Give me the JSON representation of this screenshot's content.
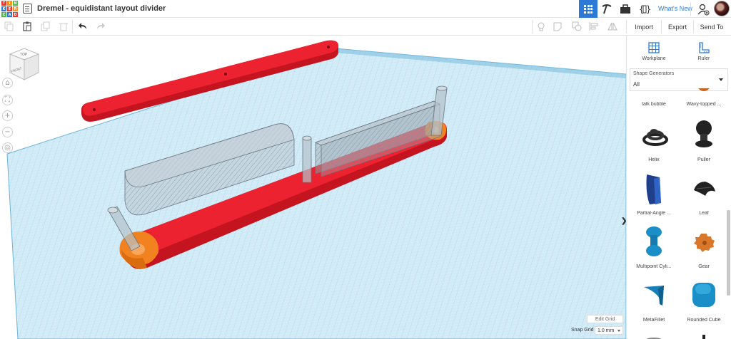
{
  "design_title": "Dremel - equidistant layout divider",
  "logo_letters": [
    "T",
    "I",
    "N",
    "K",
    "E",
    "R",
    "C",
    "A",
    "D"
  ],
  "logo_colors": [
    "#e53b2f",
    "#f7941d",
    "#53b84b",
    "#2d7ad6",
    "#e53b2f",
    "#f7941d",
    "#53b84b",
    "#2d7ad6",
    "#e53b2f"
  ],
  "topbar": {
    "whats_new": "What's New"
  },
  "toolbar": {
    "import_label": "Import",
    "export_label": "Export",
    "send_to_label": "Send To"
  },
  "viewcube": {
    "top": "TOP",
    "front": "FRONT"
  },
  "workplane": {
    "edit_grid": "Edit Grid",
    "snap_grid_label": "Snap Grid",
    "snap_grid_value": "1.0 mm"
  },
  "panel": {
    "workplane_label": "Workplane",
    "ruler_label": "Ruler",
    "shape_generators_label": "Shape Generators",
    "shape_generators_value": "All",
    "shapes": [
      {
        "name": "talk bubble",
        "icon": "talk-bubble-icon"
      },
      {
        "name": "Wavy-topped ...",
        "icon": "wavy-topped-icon"
      },
      {
        "name": "Helix",
        "icon": "helix-icon"
      },
      {
        "name": "Puller",
        "icon": "puller-icon"
      },
      {
        "name": "Partial-Angle ...",
        "icon": "partial-angle-icon"
      },
      {
        "name": "Leaf",
        "icon": "leaf-icon"
      },
      {
        "name": "Multipoint Cyli...",
        "icon": "multipoint-cylinder-icon"
      },
      {
        "name": "Gear",
        "icon": "gear-icon"
      },
      {
        "name": "MetaFillet",
        "icon": "metafillet-icon"
      },
      {
        "name": "Rounded Cube",
        "icon": "rounded-cube-icon"
      }
    ]
  },
  "colors": {
    "accent": "#2d7ad6",
    "grid_bg": "#cfe9f5",
    "grid_line": "#8fc7e0",
    "red_part": "#e8202f",
    "orange_end": "#f2821f",
    "shape_blue": "#1f5fa8",
    "shape_orange": "#d9782a",
    "shape_teal": "#1a8fc7"
  }
}
